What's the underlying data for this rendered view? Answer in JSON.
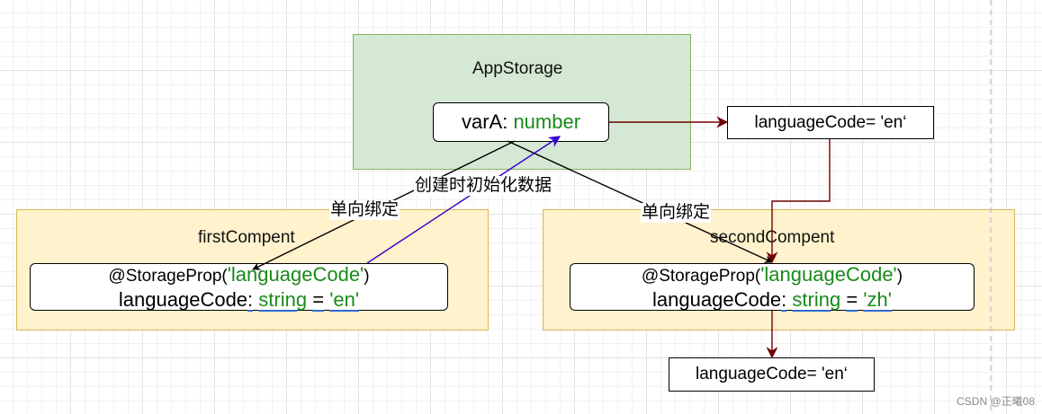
{
  "diagram": {
    "app_storage": {
      "title": "AppStorage",
      "var_name": "varA:",
      "var_type": "number"
    },
    "first_component": {
      "title": "firstCompent",
      "decorator": "@StorageProp(",
      "decorator_arg": "'languageCode'",
      "decorator_close": ")",
      "var_name": "languageCode",
      "colon": ":",
      "type": "string",
      "equals": "=",
      "value": "'en'"
    },
    "second_component": {
      "title": "secondCompent",
      "decorator": "@StorageProp(",
      "decorator_arg": "'languageCode'",
      "decorator_close": ")",
      "var_name": "languageCode",
      "colon": ":",
      "type": "string",
      "equals": "=",
      "value": "'zh'"
    },
    "value_top": "languageCode= 'en‘",
    "value_bottom": "languageCode= 'en‘",
    "edge_labels": {
      "one_way_left": "单向绑定",
      "init_data": "创建时初始化数据",
      "one_way_right": "单向绑定"
    },
    "colors": {
      "green_fill": "#d5e8d4",
      "green_stroke": "#82b366",
      "yellow_fill": "#fff2cc",
      "yellow_stroke": "#d6b656",
      "binding_arrow": "#000000",
      "init_arrow": "#3300cc",
      "value_arrow": "#6f0000",
      "code_green": "#1a8a1a"
    }
  },
  "watermark": "CSDN @正曦08"
}
